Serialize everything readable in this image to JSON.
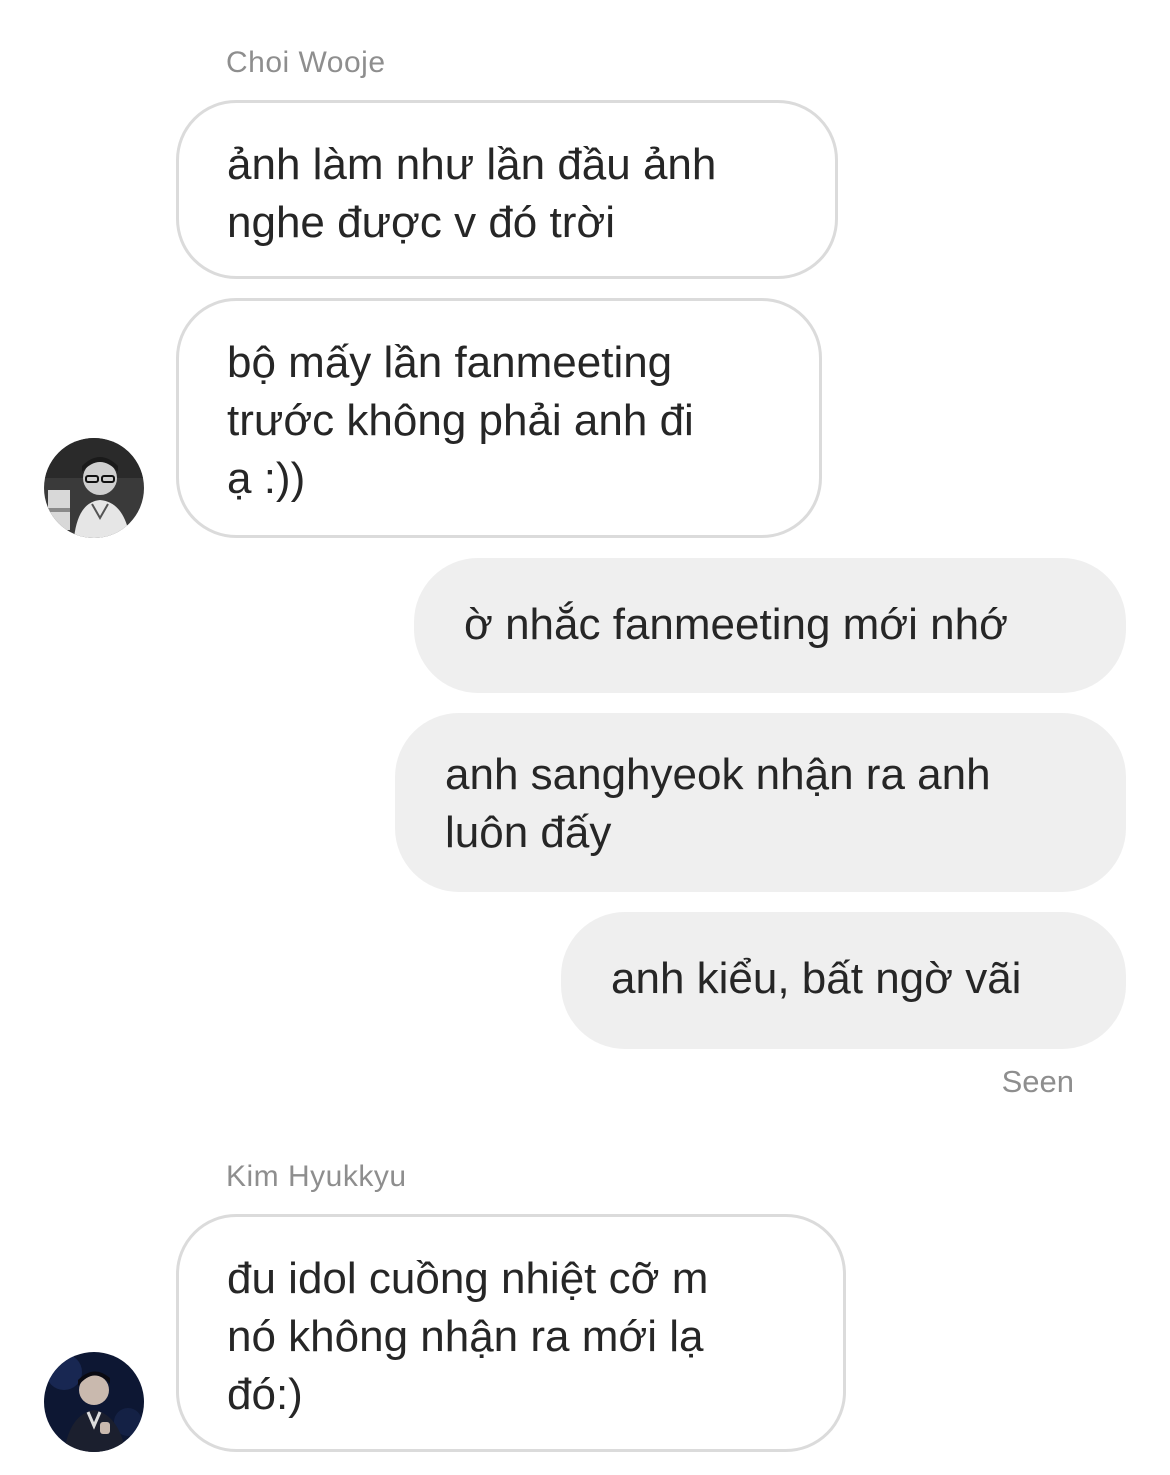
{
  "conversation": {
    "group1": {
      "sender_name": "Choi Wooje",
      "avatar": "profile-photo-choi-wooje-grayscale",
      "messages": [
        "ảnh làm như lần đầu ảnh\nnghe được v đó trời",
        "bộ mấy lần fanmeeting\ntrước không phải anh đi\nạ :))"
      ]
    },
    "own_messages": [
      "ờ nhắc fanmeeting mới nhớ",
      "anh sanghyeok nhận ra anh\nluôn đấy",
      "anh kiểu, bất ngờ vãi"
    ],
    "seen_label": "Seen",
    "group2": {
      "sender_name": "Kim Hyukkyu",
      "avatar": "profile-photo-kim-hyukkyu-dark-blue",
      "messages": [
        "đu idol cuồng nhiệt cỡ m\nnó không nhận ra mới lạ\nđó:)"
      ]
    }
  },
  "colors": {
    "incoming_bubble_bg": "#ffffff",
    "incoming_bubble_border": "#dbdbdb",
    "outgoing_bubble_bg": "#efefef",
    "text": "#262626",
    "meta_text": "#8e8e8e"
  }
}
